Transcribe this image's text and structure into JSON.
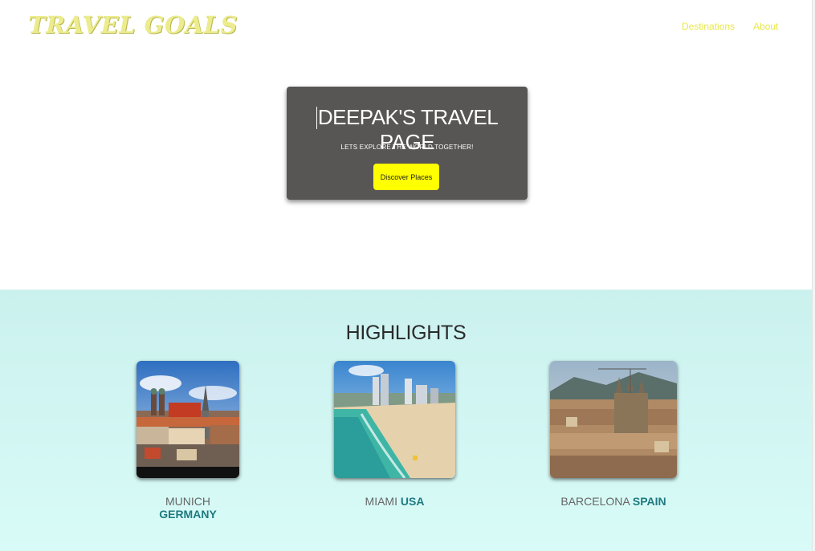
{
  "header": {
    "logo": "TRAVEL GOALS",
    "nav": [
      "Destinations",
      "About"
    ]
  },
  "hero": {
    "title": "DEEPAK'S TRAVEL PAGE",
    "subtitle": "LETS EXPLORE THE WORLD TOGETHER!",
    "button": "Discover Places"
  },
  "highlights": {
    "title": "HIGHLIGHTS",
    "items": [
      {
        "city": "MUNICH",
        "country": "GERMANY"
      },
      {
        "city": "MIAMI",
        "country": "USA"
      },
      {
        "city": "BARCELONA",
        "country": "SPAIN"
      }
    ]
  },
  "colors": {
    "accent_yellow": "#ffff00",
    "hero_bg": "#585654",
    "highlights_bg": "#cbf1ee",
    "country_text": "#1f7a80"
  }
}
